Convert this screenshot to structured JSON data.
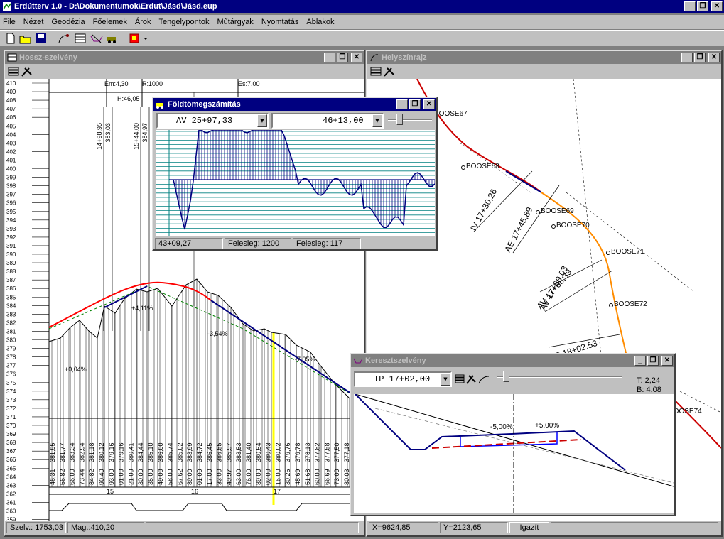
{
  "app": {
    "title": "Erdútterv 1.0 - D:\\Dokumentumok\\Erdut\\Jásd\\Jásd.eup",
    "menu": [
      "File",
      "Nézet",
      "Geodézia",
      "Főelemek",
      "Árok",
      "Tengelypontok",
      "Műtárgyak",
      "Nyomtatás",
      "Ablakok"
    ],
    "window_buttons": {
      "minimize": "_",
      "restore": "❐",
      "close": "✕"
    }
  },
  "hossz": {
    "title": "Hossz-szelvény",
    "header_labels": {
      "em": "Em:4,30",
      "r": "R:1000",
      "es": "Es:7,00",
      "h": "H:46,05"
    },
    "y_labels": [
      "410",
      "409",
      "408",
      "407",
      "406",
      "405",
      "404",
      "403",
      "402",
      "401",
      "400",
      "399",
      "398",
      "397",
      "396",
      "395",
      "394",
      "393",
      "392",
      "391",
      "390",
      "389",
      "388",
      "387",
      "386",
      "385",
      "384",
      "383",
      "382",
      "381",
      "380",
      "379",
      "378",
      "377",
      "376",
      "375",
      "374",
      "373",
      "372",
      "371",
      "370",
      "369",
      "368",
      "367",
      "366",
      "365",
      "364",
      "363",
      "362",
      "361",
      "360",
      "359",
      "358"
    ],
    "vertical_labels": [
      "14+98,95",
      "383,03",
      "15+44,00",
      "384,97"
    ],
    "grades": [
      "+0,04%",
      "+4,11%",
      "-3,54%",
      "-7,05%"
    ],
    "elev_labels": [
      "381,95",
      "381,77",
      "383,34",
      "382,94",
      "381,18",
      "380,12",
      "379,16",
      "379,16",
      "380,41",
      "384,44",
      "385,10",
      "386,00",
      "385,74",
      "385,02",
      "383,99",
      "384,72",
      "386,45",
      "386,55",
      "385,97",
      "383,53",
      "381,40",
      "380,54",
      "380,43",
      "380,02",
      "379,76",
      "379,78",
      "378,13",
      "377,82",
      "377,58",
      "377,50",
      "377,18",
      "376,83"
    ],
    "station_labels": [
      "46,31",
      "56,82",
      "66,00",
      "73,44",
      "84,82",
      "90,40",
      "93,00",
      "01,00",
      "21,00",
      "30,00",
      "35,00",
      "49,00",
      "58,00",
      "67,62",
      "89,00",
      "01,00",
      "17,00",
      "33,00",
      "49,97",
      "63,00",
      "76,00",
      "89,00",
      "02,00",
      "15,00",
      "30,26",
      "45,69",
      "51,68",
      "60,00",
      "66,69",
      "73,00",
      "80,03",
      "86,00"
    ],
    "km_labels": [
      "15",
      "16",
      "17"
    ],
    "status": {
      "szelv": "Szelv.: 1753,03",
      "mag": "Mag.:410,20"
    }
  },
  "helyszin": {
    "title": "Helyszínrajz",
    "points": [
      "BOOSE67",
      "BOOSE68",
      "BOOSE69",
      "BOOSE70",
      "BOOSE71",
      "BOOSE72",
      "BOOSE73",
      "BOOSE74"
    ],
    "tangent_labels": [
      "IV 17+30,26",
      "AE 17+45,89",
      "AV 17+68,39",
      "AV 17+80,03",
      "AE 18+02,53"
    ],
    "status": {
      "x": "X=9624,85",
      "y": "Y=2123,65",
      "btn": "Igazít"
    }
  },
  "foldtomeg": {
    "title": "Földtömegszámítás",
    "combo_left": "AV 25+97,33",
    "combo_right": "46+13,00",
    "status": {
      "pos": "43+09,27",
      "fel1": "Felesleg: 1200",
      "fel2": "Felesleg: 117"
    }
  },
  "kereszt": {
    "title": "Keresztszelvény",
    "combo": "IP 17+02,00",
    "t": "T: 2,24",
    "b": "B: 4,08",
    "slopes": [
      "-5,00%",
      "+5,00%"
    ]
  }
}
